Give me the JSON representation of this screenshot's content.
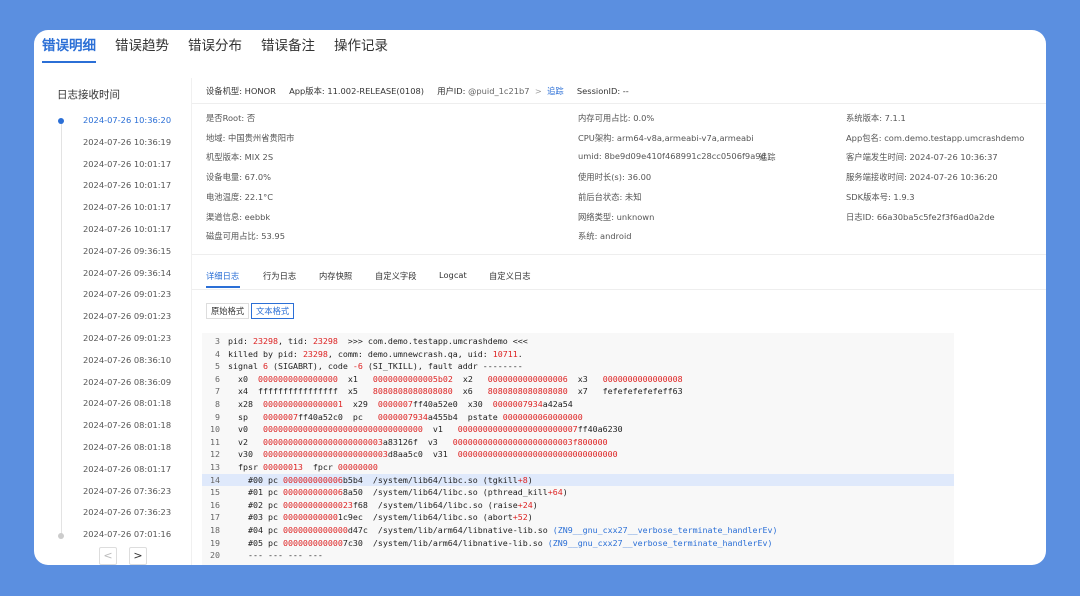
{
  "top_tabs": [
    "错误明细",
    "错误趋势",
    "错误分布",
    "错误备注",
    "操作记录"
  ],
  "left": {
    "title": "日志接收时间",
    "times": [
      "2024-07-26 10:36:20",
      "2024-07-26 10:36:19",
      "2024-07-26 10:01:17",
      "2024-07-26 10:01:17",
      "2024-07-26 10:01:17",
      "2024-07-26 10:01:17",
      "2024-07-26 09:36:15",
      "2024-07-26 09:36:14",
      "2024-07-26 09:01:23",
      "2024-07-26 09:01:23",
      "2024-07-26 09:01:23",
      "2024-07-26 08:36:10",
      "2024-07-26 08:36:09",
      "2024-07-26 08:01:18",
      "2024-07-26 08:01:18",
      "2024-07-26 08:01:18",
      "2024-07-26 08:01:17",
      "2024-07-26 07:36:23",
      "2024-07-26 07:36:23",
      "2024-07-26 07:01:16"
    ],
    "prev": "<",
    "next": ">"
  },
  "info_bar": {
    "model": "设备机型: HONOR",
    "app_version": "App版本: 11.002-RELEASE(0108)",
    "user_id_label": "用户ID:",
    "user_id": "@puid_1c21b7",
    "sep": ">",
    "track": "追踪",
    "session": "SessionID: --"
  },
  "details": {
    "col1": [
      "是否Root: 否",
      "地域: 中国贵州省贵阳市",
      "机型版本: MIX 2S",
      "设备电量: 67.0%",
      "电池温度: 22.1°C",
      "渠道信息: eebbk",
      "磁盘可用占比: 53.95"
    ],
    "col2": [
      "内存可用占比: 0.0%",
      "CPU架构: arm64-v8a,armeabi-v7a,armeabi",
      "umid: 8be9d09e410f468991c28cc0506f9a9d",
      "使用时长(s): 36.00",
      "前后台状态: 未知",
      "网络类型: unknown",
      "系统: android"
    ],
    "umid_track": "追踪",
    "col3": [
      "系统版本: 7.1.1",
      "App包名: com.demo.testapp.umcrashdemo",
      "客户端发生时间: 2024-07-26 10:36:37",
      "服务端接收时间: 2024-07-26 10:36:20",
      "SDK版本号: 1.9.3",
      "日志ID: 66a30ba5c5fe2f3f6ad0a2de"
    ]
  },
  "sub_tabs": [
    "详细日志",
    "行为日志",
    "内存快照",
    "自定义字段",
    "Logcat",
    "自定义日志"
  ],
  "format_buttons": [
    "原始格式",
    "文本格式"
  ],
  "code_lines": [
    {
      "n": "3",
      "html": "pid: <span class=\"r\">23298</span>, tid: <span class=\"r\">23298</span>  &gt;&gt;&gt; com.demo.testapp.umcrashdemo &lt;&lt;&lt;"
    },
    {
      "n": "4",
      "html": "killed by pid: <span class=\"r\">23298</span>, comm: demo.umnewcrash.qa, uid: <span class=\"r\">10711</span>."
    },
    {
      "n": "5",
      "html": "signal <span class=\"r\">6</span> (SIGABRT), code <span class=\"r\">-6</span> (SI_TKILL), fault addr --------"
    },
    {
      "n": "6",
      "html": "  x0  <span class=\"r\">0000000000000000</span>  x1   <span class=\"r\">0000000000005b02</span>  x2   <span class=\"r\">0000000000000006</span>  x3   <span class=\"r\">0000000000000008</span>"
    },
    {
      "n": "7",
      "html": "  x4  ffffffffffffffff  x5   <span class=\"r\">8080808080808080</span>  x6   <span class=\"r\">8080808080808080</span>  x7   fefefefefefeff63"
    },
    {
      "n": "8",
      "html": "  x28  <span class=\"r\">0000000000000001</span>  x29  <span class=\"r\">0000007</span>ff40a52e0  x30  <span class=\"r\">0000007934</span>a42a54"
    },
    {
      "n": "9",
      "html": "  sp   <span class=\"r\">0000007</span>ff40a52c0  pc   <span class=\"r\">0000007934</span>a455b4  pstate <span class=\"r\">0000000060000000</span>"
    },
    {
      "n": "10",
      "html": "  v0   <span class=\"r\">00000000000000000000000000000000</span>  v1   <span class=\"r\">000000000000000000000007</span>ff40a6230"
    },
    {
      "n": "11",
      "html": "  v2   <span class=\"r\">000000000000000000000003</span>a83126f  v3   <span class=\"r\">000000000000000000000003f800000</span>"
    },
    {
      "n": "12",
      "html": "  v30  <span class=\"r\">0000000000000000000000003</span>d8aa5c0  v31  <span class=\"r\">00000000000000000000000000000000</span>"
    },
    {
      "n": "13",
      "html": "  fpsr <span class=\"r\">00000013</span>  fpcr <span class=\"r\">00000000</span>"
    },
    {
      "n": "14",
      "html": "    #00 pc <span class=\"r\">000000000006</span>b5b4  /system/lib64/libc.so (tgkill<span class=\"r\">+8</span>)",
      "hl": true
    },
    {
      "n": "15",
      "html": "    #01 pc <span class=\"r\">000000000006</span>8a50  /system/lib64/libc.so (pthread_kill<span class=\"r\">+64</span>)"
    },
    {
      "n": "16",
      "html": "    #02 pc <span class=\"r\">00000000000023</span>f68  /system/lib64/libc.so (raise<span class=\"r\">+24</span>)"
    },
    {
      "n": "17",
      "html": "    #03 pc <span class=\"r\">00000000000</span>1c9ec  /system/lib64/libc.so (abort<span class=\"r\">+52</span>)"
    },
    {
      "n": "18",
      "html": "    #04 pc <span class=\"r\">0000000000000</span>d47c  /system/lib/arm64/libnative-lib.so <span class=\"b\">(ZN9__gnu_cxx27__verbose_terminate_handlerEv)</span>"
    },
    {
      "n": "19",
      "html": "    #05 pc <span class=\"r\">000000000000</span>7c30  /system/lib/arm64/libnative-lib.so <span class=\"b\">(ZN9__gnu_cxx27__verbose_terminate_handlerEv)</span>"
    },
    {
      "n": "20",
      "html": "    --- --- --- ---"
    }
  ],
  "colors": {
    "accent": "#2b6fd6",
    "background": "#5b8fe0",
    "error_red": "#d22"
  }
}
